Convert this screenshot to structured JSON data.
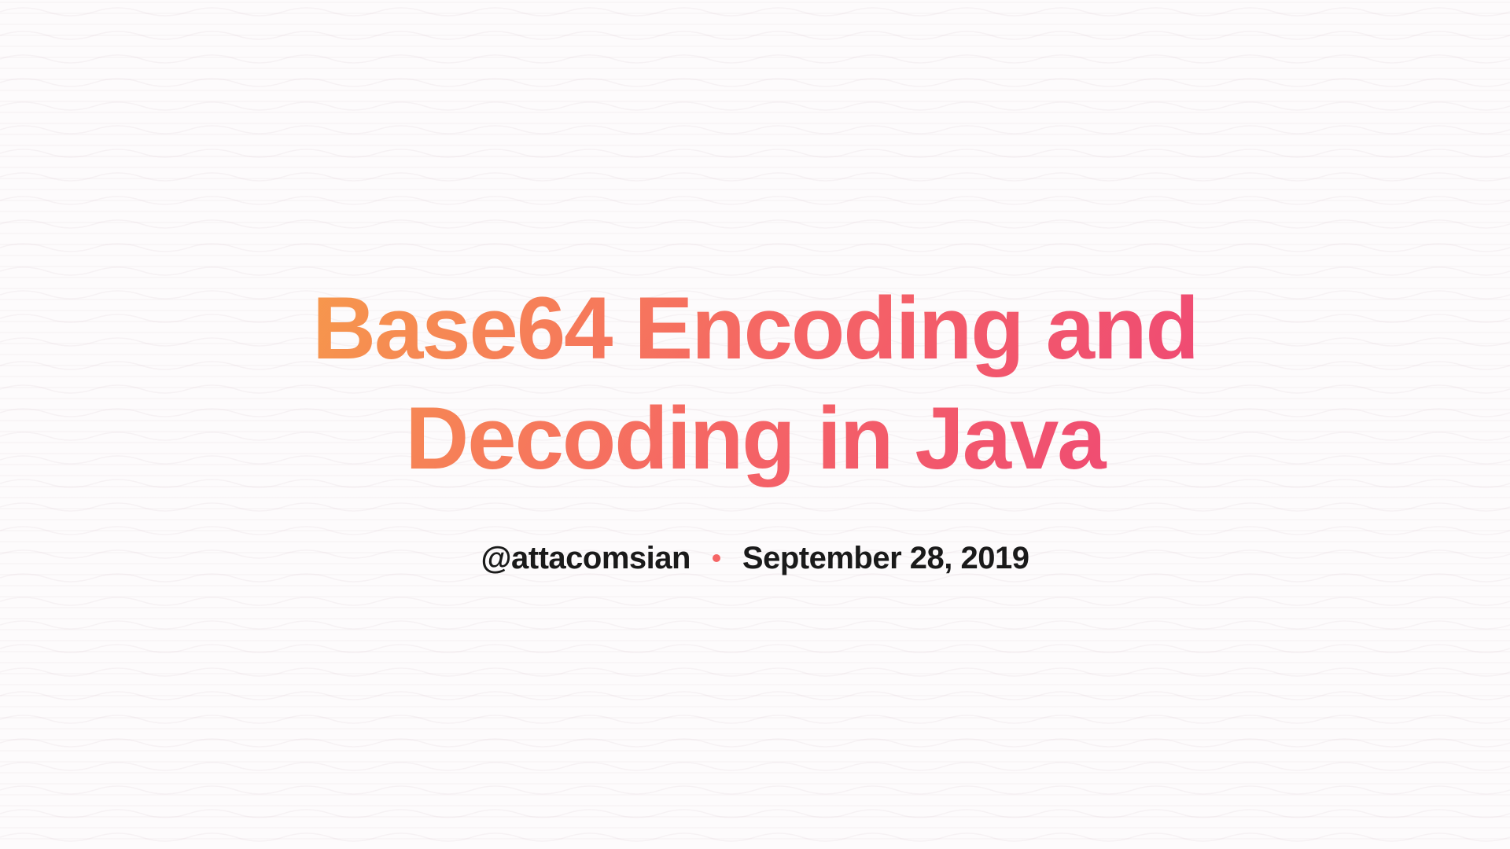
{
  "title": "Base64 Encoding and Decoding in Java",
  "author": "@attacomsian",
  "date": "September 28, 2019",
  "colors": {
    "gradient_start": "#f7a048",
    "gradient_mid": "#f56565",
    "gradient_end": "#ed4278",
    "separator": "#f56565",
    "text": "#1a1a1a",
    "background": "#fdfbfc"
  }
}
